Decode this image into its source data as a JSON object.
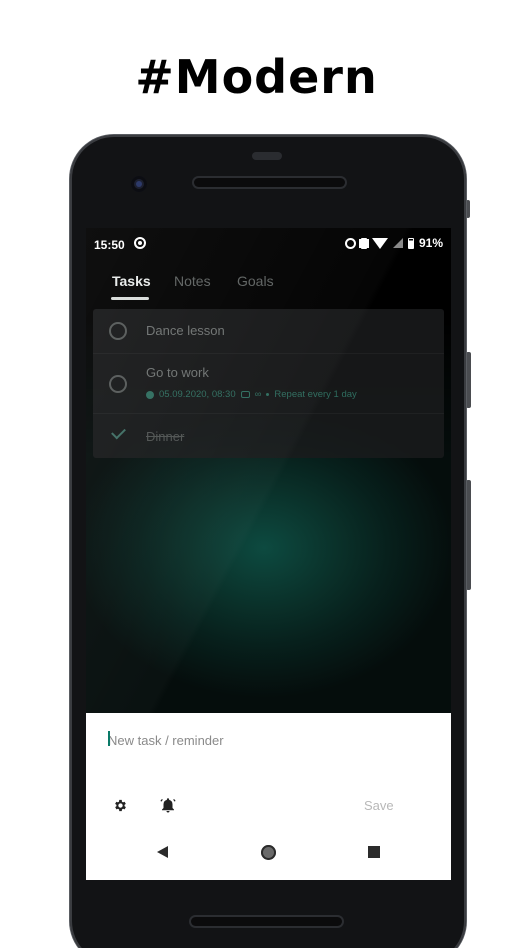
{
  "headline": "#Modern",
  "status_bar": {
    "time": "15:50",
    "battery": "91%"
  },
  "tabs": [
    {
      "label": "Tasks",
      "active": true
    },
    {
      "label": "Notes",
      "active": false
    },
    {
      "label": "Goals",
      "active": false
    }
  ],
  "tasks": [
    {
      "title": "Dance lesson",
      "done": false
    },
    {
      "title": "Go to work",
      "done": false,
      "date": "05.09.2020, 08:30",
      "repeat_count": "∞",
      "repeat": "Repeat every 1 day"
    },
    {
      "title": "Dinner",
      "done": true
    }
  ],
  "composer": {
    "placeholder": "New task / reminder",
    "save_label": "Save"
  },
  "icons": {
    "settings": "gear-icon",
    "reminder": "alarm-bell-icon",
    "back": "back-triangle-icon",
    "home": "home-circle-icon",
    "recents": "recents-square-icon"
  },
  "colors": {
    "accent": "#0a7a68",
    "screen_glow": "#0d4a40"
  }
}
